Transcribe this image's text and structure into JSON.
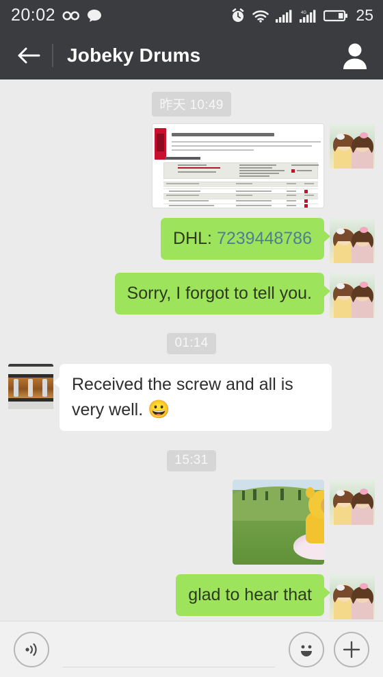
{
  "statusbar": {
    "time": "20:02",
    "battery_percent": "25",
    "icons": [
      "infinity-icon",
      "message-bubble-icon",
      "alarm-clock-icon",
      "wifi-icon",
      "signal-bars-icon",
      "signal-4g-icon",
      "battery-icon"
    ]
  },
  "appbar": {
    "back_icon": "back-arrow-icon",
    "title": "Jobeky Drums",
    "contact_icon": "contact-person-icon"
  },
  "chat": {
    "items": [
      {
        "kind": "timestamp",
        "text": "昨天 10:49"
      },
      {
        "kind": "image",
        "side": "out",
        "name": "dhl-tracking-screenshot",
        "alt": "Track DHL Express Shipments tracking result page"
      },
      {
        "kind": "text",
        "side": "out",
        "prefix": "DHL: ",
        "link": "7239448786"
      },
      {
        "kind": "text",
        "side": "out",
        "text": "Sorry, I forgot to tell you."
      },
      {
        "kind": "timestamp",
        "text": "01:14"
      },
      {
        "kind": "text",
        "side": "in",
        "text": "Received the screw and all is very well. ",
        "emoji": "😀"
      },
      {
        "kind": "timestamp",
        "text": "15:31"
      },
      {
        "kind": "image",
        "side": "out",
        "name": "child-costume-photo",
        "alt": "Child in yellow Teletubby costume with pink tutu on a grassy hill"
      },
      {
        "kind": "text",
        "side": "out",
        "text": "glad to hear that"
      }
    ]
  },
  "inputbar": {
    "voice_icon": "voice-wave-icon",
    "input_value": "",
    "input_placeholder": "",
    "emoji_icon": "smiley-face-icon",
    "plus_icon": "plus-icon"
  },
  "colors": {
    "bar": "#3b3c40",
    "chat_bg": "#ebebeb",
    "bubble_out": "#9ee35c",
    "bubble_in": "#ffffff",
    "link": "#4d7f92",
    "timestamp_chip": "#d6d6d6"
  }
}
